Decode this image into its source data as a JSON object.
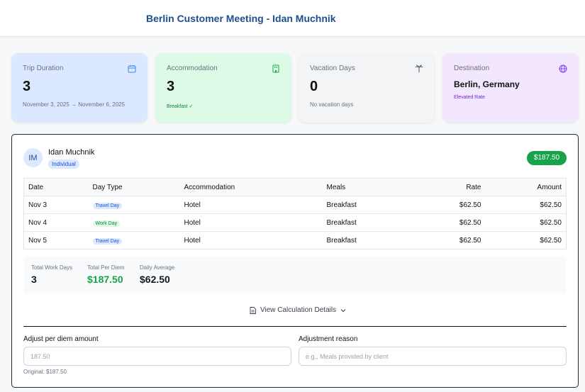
{
  "header": {
    "title": "Berlin Customer Meeting - Idan Muchnik"
  },
  "summary_cards": [
    {
      "label": "Trip Duration",
      "value": "3",
      "sub": "November 3, 2025 → November 6, 2025",
      "icon": "calendar-icon"
    },
    {
      "label": "Accommodation",
      "value": "3",
      "sub": "Breakfast ✓",
      "icon": "hotel-icon"
    },
    {
      "label": "Vacation Days",
      "value": "0",
      "sub": "No vacation days",
      "icon": "palm-tree-icon"
    },
    {
      "label": "Destination",
      "value": "Berlin, Germany",
      "sub": "Elevated Rate",
      "icon": "globe-icon"
    }
  ],
  "traveler": {
    "initials": "IM",
    "name": "Idan Muchnik",
    "type": "Individual",
    "total": "$187.50"
  },
  "table": {
    "columns": [
      "Date",
      "Day Type",
      "Accommodation",
      "Meals",
      "Rate",
      "Amount"
    ],
    "rows": [
      {
        "date": "Nov 3",
        "day_type": "Travel Day",
        "accommodation": "Hotel",
        "meals": "Breakfast",
        "rate": "$62.50",
        "amount": "$62.50"
      },
      {
        "date": "Nov 4",
        "day_type": "Work Day",
        "accommodation": "Hotel",
        "meals": "Breakfast",
        "rate": "$62.50",
        "amount": "$62.50"
      },
      {
        "date": "Nov 5",
        "day_type": "Travel Day",
        "accommodation": "Hotel",
        "meals": "Breakfast",
        "rate": "$62.50",
        "amount": "$62.50"
      }
    ]
  },
  "stats": {
    "work_days_label": "Total Work Days",
    "work_days": "3",
    "per_diem_label": "Total Per Diem",
    "per_diem": "$187.50",
    "daily_avg_label": "Daily Average",
    "daily_avg": "$62.50"
  },
  "calc_link": "View Calculation Details",
  "adjust": {
    "amount_label": "Adjust per diem amount",
    "amount_placeholder": "187.50",
    "reason_label": "Adjustment reason",
    "reason_placeholder": "e.g., Meals provided by client",
    "original_note": "Original: $187.50"
  },
  "colors": {
    "title": "#1e4e8c",
    "card_blue": "#dbe8fd",
    "card_green": "#dcfae6",
    "card_gray": "#f3f4f6",
    "card_purple": "#f2e7fe",
    "success": "#16a34a"
  }
}
